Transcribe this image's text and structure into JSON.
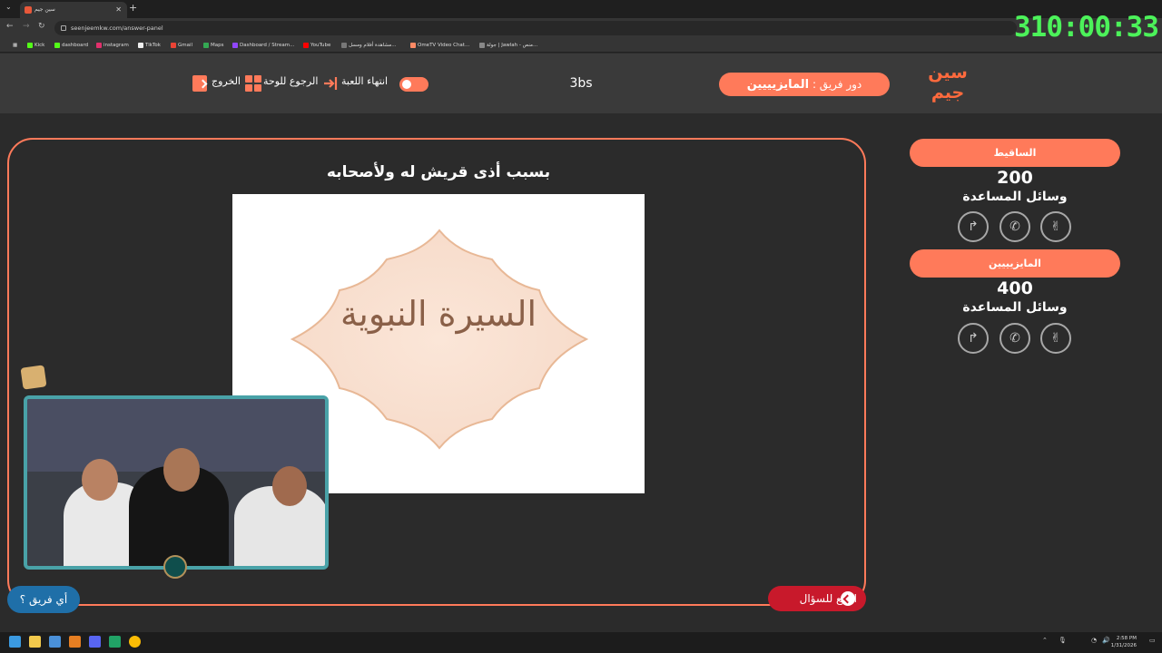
{
  "browser": {
    "tab_title": "سين جيم",
    "url": "seenjeemkw.com/answer-panel",
    "bookmarks": [
      "Kick",
      "dashboard",
      "instagram",
      "TikTok",
      "Gmail",
      "Maps",
      "Dashboard / Stream...",
      "YouTube",
      "مشاهدة أفلام ومسل...",
      "OmeTV Video Chat...",
      "جولة | Jawlah - منص..."
    ],
    "overlay_timer": "310:00:33"
  },
  "header": {
    "logo_line1": "سين",
    "logo_line2": "جيم",
    "turn_label": "دور فريق :",
    "turn_team": "المايزيييين",
    "game_code": "3bs",
    "end_game_label": "انتهاء اللعبة",
    "back_to_board_label": "الرجوع للوحة",
    "exit_label": "الخروج"
  },
  "question": {
    "text": "بسبب أذى قريش له ولأصحابه",
    "image_caption": "السيرة النبوية",
    "back_to_question_label": "ارجع للسؤال",
    "which_team_label": "أي فريق ؟"
  },
  "teams": [
    {
      "name": "الساقيط",
      "score": "200",
      "helps_label": "وسائل المساعدة"
    },
    {
      "name": "المايزيييين",
      "score": "400",
      "helps_label": "وسائل المساعدة"
    }
  ],
  "taskbar": {
    "time": "2:58 PM",
    "date": "1/31/2026"
  },
  "colors": {
    "accent": "#ff7a5a",
    "danger": "#c8192b",
    "info": "#1f6fa8",
    "timer": "#4cf25a"
  }
}
